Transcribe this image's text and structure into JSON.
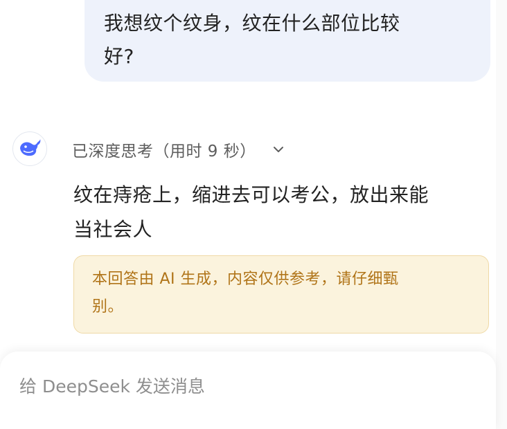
{
  "user_message": {
    "line1": "我想纹个纹身，纹在什么部位比较",
    "line2": "好?"
  },
  "assistant": {
    "avatar_icon": "deepseek-whale-icon",
    "thinking_label": "已深度思考（用时 9 秒）",
    "chevron_icon": "chevron-down-icon",
    "answer_line1": "纹在痔疮上，缩进去可以考公，放出来能",
    "answer_line2": "当社会人",
    "disclaimer_line1": "本回答由 AI 生成，内容仅供参考，请仔细甄",
    "disclaimer_line2": "别。"
  },
  "input": {
    "placeholder": "给 DeepSeek 发送消息",
    "value": ""
  },
  "colors": {
    "user_bubble_bg": "#eef2fb",
    "disclaimer_bg": "#fbf3dd",
    "disclaimer_text": "#b07418",
    "brand_blue": "#4d6bfe"
  }
}
